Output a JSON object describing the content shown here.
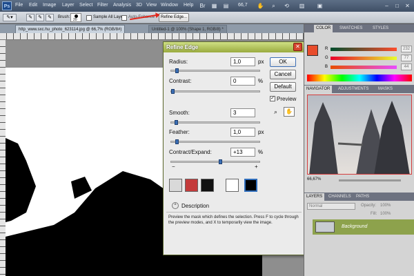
{
  "app": {
    "logo": "Ps",
    "menu": [
      "File",
      "Edit",
      "Image",
      "Layer",
      "Select",
      "Filter",
      "Analysis",
      "3D",
      "View",
      "Window",
      "Help"
    ],
    "zoom_readout": "66,7"
  },
  "options_bar": {
    "brush_label": "Brush:",
    "brush_size": "20",
    "sample_all_layers": "Sample All Layers",
    "auto_enhance": "Auto-Enhance",
    "refine_edge_button": "Refine Edge..."
  },
  "document_tabs": [
    {
      "label": "http_www.sxc.hu_photo_623114.jpg @ 66,7% (RGB/8#)",
      "active": true
    },
    {
      "label": "Untitled-1 @ 100% (Shape 1, RGB/8) *",
      "active": false
    }
  ],
  "dialog": {
    "title": "Refine Edge",
    "close_glyph": "✕",
    "radius": {
      "label": "Radius:",
      "value": "1,0",
      "unit": "px",
      "level": 0.05
    },
    "contrast": {
      "label": "Contrast:",
      "value": "0",
      "unit": "%",
      "level": 0.0
    },
    "smooth": {
      "label": "Smooth:",
      "value": "3",
      "level": 0.04
    },
    "feather": {
      "label": "Feather:",
      "value": "1,0",
      "unit": "px",
      "level": 0.05
    },
    "contract_expand": {
      "label": "Contract/Expand:",
      "value": "+13",
      "unit": "%",
      "level": 0.565,
      "minus": "−",
      "plus": "+"
    },
    "buttons": {
      "ok": "OK",
      "cancel": "Cancel",
      "default": "Default"
    },
    "preview_label": "Preview",
    "description_toggle": "Description",
    "description": "Preview the mask which defines the selection. Press F to cycle through the preview modes, and X to temporarily view the image."
  },
  "panels": {
    "color_tabs": [
      "COLOR",
      "SWATCHES",
      "STYLES"
    ],
    "color_values": {
      "r": "232",
      "g": "77",
      "b": "44"
    },
    "nav_tabs": [
      "NAVIGATOR",
      "ADJUSTMENTS",
      "MASKS"
    ],
    "nav_zoom": "66,67%",
    "layer_tabs": [
      "LAYERS",
      "CHANNELS",
      "PATHS"
    ],
    "blend_mode": "Normal",
    "opacity_label": "Opacity:",
    "opacity_value": "100%",
    "fill_label": "Fill:",
    "fill_value": "100%",
    "layer_name": "Background"
  },
  "colors": {
    "accent_dialog": "#a9bb4c",
    "foreground_swatch": "#e84d2c",
    "selected_layer": "#8da24c"
  }
}
